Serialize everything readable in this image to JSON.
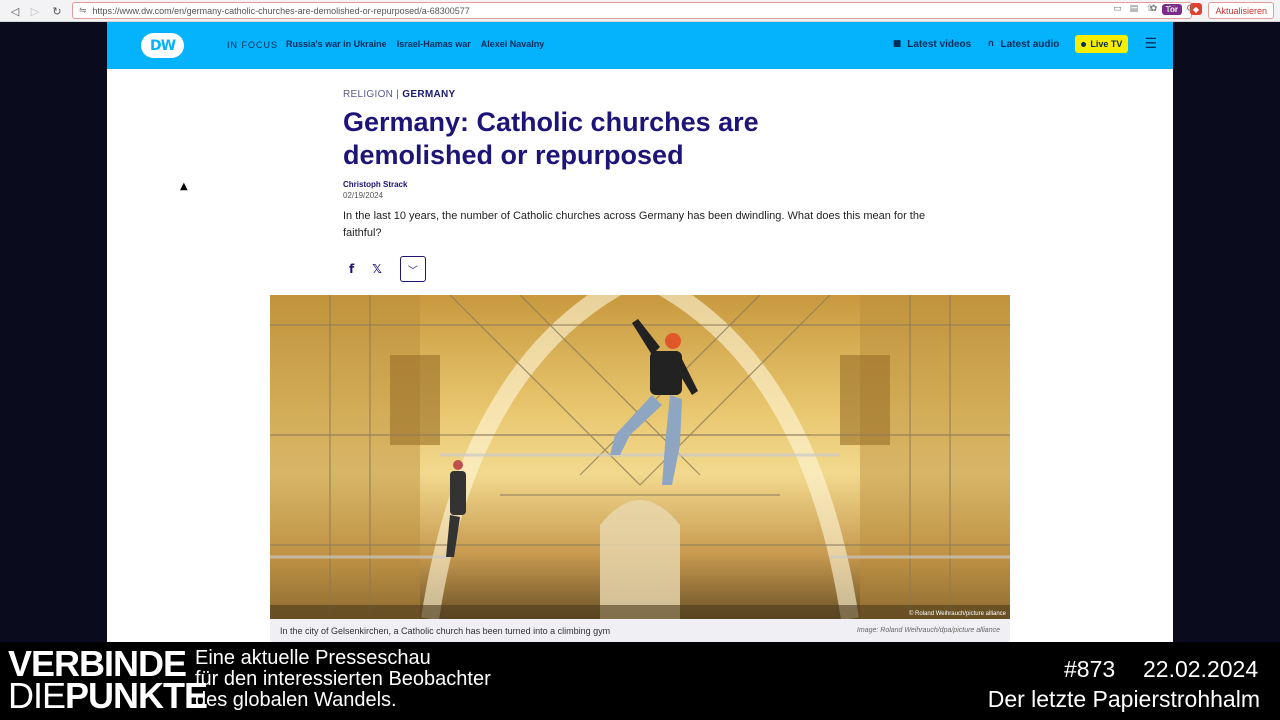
{
  "browser": {
    "url": "https://www.dw.com/en/germany-catholic-churches-are-demolished-or-repurposed/a-68300577",
    "tor_label": "Tor",
    "update_label": "Aktualisieren"
  },
  "header": {
    "logo": "DW",
    "in_focus_label": "IN FOCUS",
    "focus_links": [
      "Russia's war in Ukraine",
      "Israel-Hamas war",
      "Alexei Navalny"
    ],
    "latest_videos": "Latest videos",
    "latest_audio": "Latest audio",
    "live_tv": "Live TV"
  },
  "article": {
    "kicker_category": "RELIGION",
    "kicker_separator": " | ",
    "kicker_region": "GERMANY",
    "headline": "Germany: Catholic churches are demolished or repurposed",
    "author": "Christoph Strack",
    "date": "02/19/2024",
    "teaser": "In the last 10 years, the number of Catholic churches across Germany has been dwindling. What does this mean for the faithful?",
    "image_caption": "In the city of Gelsenkirchen, a Catholic church has been turned into a climbing gym",
    "image_credit": "Image: Roland Weihrauch/dpa/picture alliance",
    "image_overlay_credit": "© Roland Weihrauch/picture alliance"
  },
  "share": {
    "facebook_icon": "f",
    "x_icon": "𝕏",
    "more_icon": "﹀"
  },
  "footer": {
    "brand_line1": "VERBINDE",
    "brand_line2_a": "DIE",
    "brand_line2_b": "PUNKTE",
    "tagline_1": "Eine aktuelle Presseschau",
    "tagline_2": "für den interessierten Beobachter",
    "tagline_3": "des globalen Wandels.",
    "episode": "#873",
    "episode_date": "22.02.2024",
    "episode_title": "Der letzte Papierstrohhalm"
  }
}
